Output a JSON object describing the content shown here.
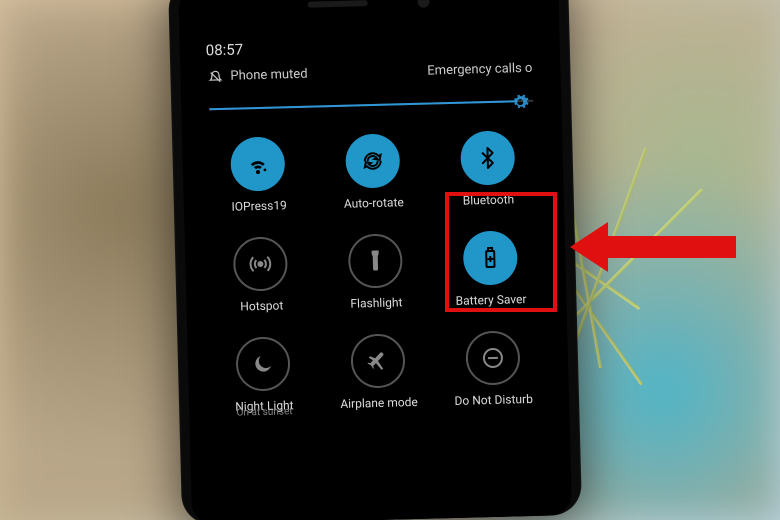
{
  "status": {
    "time": "08:57"
  },
  "alert": {
    "muted_label": "Phone muted",
    "emergency_label": "Emergency calls o"
  },
  "brightness": {
    "percent": 95
  },
  "tiles": [
    {
      "id": "wifi",
      "label": "IOPress19",
      "style": "active"
    },
    {
      "id": "autorotate",
      "label": "Auto-rotate",
      "style": "active"
    },
    {
      "id": "bluetooth",
      "label": "Bluetooth",
      "style": "active"
    },
    {
      "id": "hotspot",
      "label": "Hotspot",
      "style": "inactive"
    },
    {
      "id": "flashlight",
      "label": "Flashlight",
      "style": "inactive"
    },
    {
      "id": "battery",
      "label": "Battery Saver",
      "style": "active"
    },
    {
      "id": "nightlight",
      "label": "Night Light",
      "sublabel": "On at sunset",
      "style": "inactive"
    },
    {
      "id": "airplane",
      "label": "Airplane mode",
      "style": "inactive"
    },
    {
      "id": "dnd",
      "label": "Do Not Disturb",
      "style": "inactive"
    }
  ],
  "colors": {
    "accent": "#2196c9",
    "highlight": "#e01010"
  },
  "annotation": {
    "target_tile": "bluetooth"
  }
}
